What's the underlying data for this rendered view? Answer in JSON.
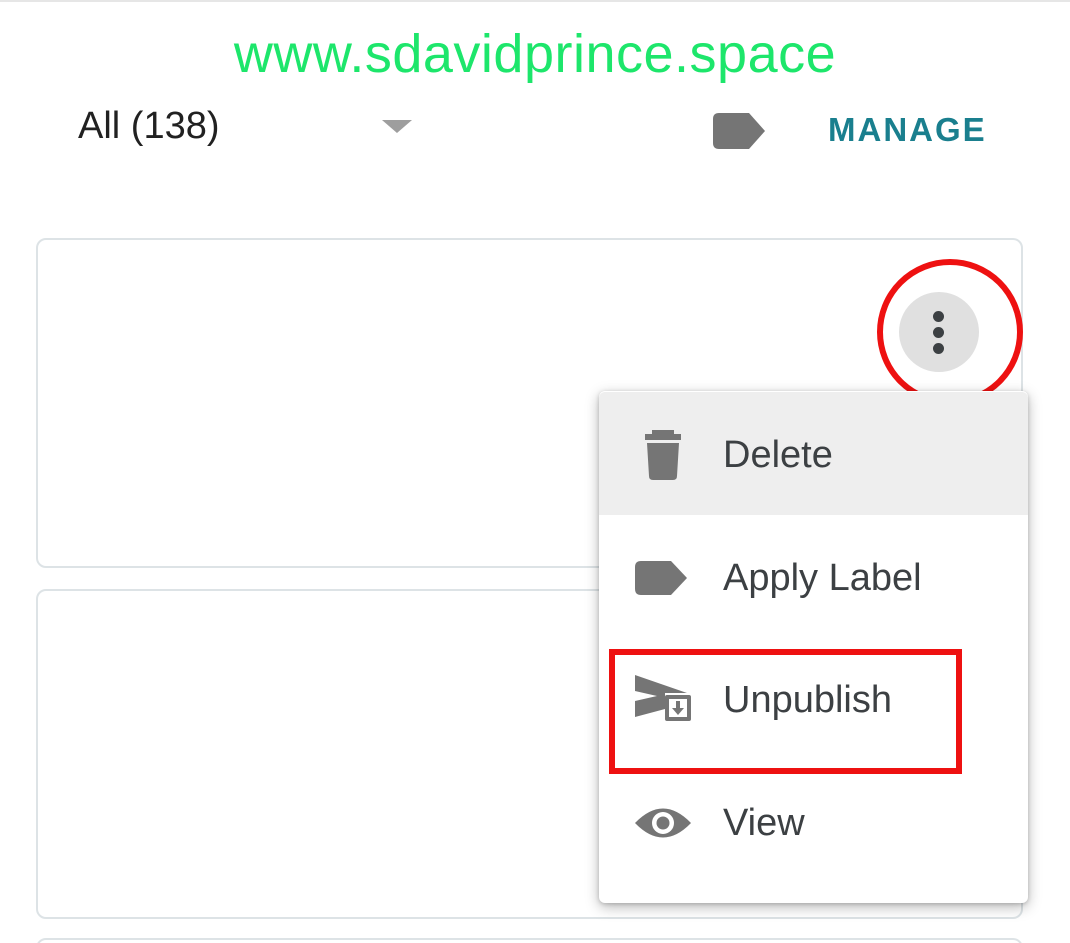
{
  "watermark": "www.sdavidprince.space",
  "toolbar": {
    "filter_label": "All (138)",
    "label_icon": "label-icon",
    "manage_label": "MANAGE"
  },
  "colors": {
    "accent": "#1a7f8e",
    "watermark": "#1de66b",
    "annotation": "#ee1111",
    "icon": "#757575"
  },
  "post_card": {
    "more_icon": "more-vert-icon"
  },
  "menu": {
    "items": [
      {
        "label": "Delete",
        "icon": "trash-icon"
      },
      {
        "label": "Apply Label",
        "icon": "label-icon"
      },
      {
        "label": "Unpublish",
        "icon": "unpublish-icon"
      },
      {
        "label": "View",
        "icon": "eye-icon"
      }
    ]
  }
}
